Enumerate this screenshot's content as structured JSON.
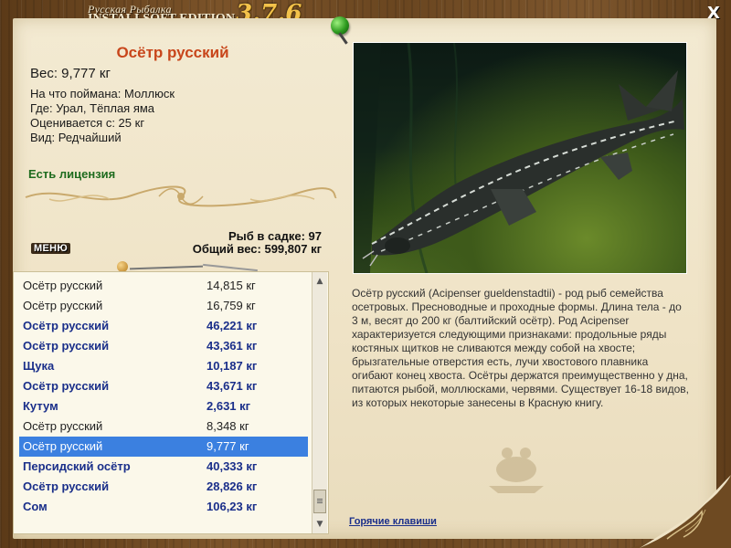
{
  "app": {
    "title_line1": "Русская Рыбалка",
    "title_line2": "INSTALLSOFT EDITION",
    "version": "3.7.6",
    "close_label": "X"
  },
  "fish": {
    "name": "Осётр русский",
    "weight_label": "Вес: 9,777 кг",
    "caught_on": "На что поймана: Моллюск",
    "location": "Где: Урал, Тёплая яма",
    "valued_from": "Оценивается с: 25 кг",
    "rarity": "Вид: Редчайший",
    "license": "Есть лицензия"
  },
  "stats": {
    "count": "Рыб в садке: 97",
    "total": "Общий вес: 599,807 кг"
  },
  "menu_label": "МЕНЮ",
  "catch_list": [
    {
      "name": "Осётр русский",
      "weight": "14,815 кг",
      "bold": false,
      "selected": false
    },
    {
      "name": "Осётр русский",
      "weight": "16,759 кг",
      "bold": false,
      "selected": false
    },
    {
      "name": "Осётр русский",
      "weight": "46,221 кг",
      "bold": true,
      "selected": false
    },
    {
      "name": "Осётр русский",
      "weight": "43,361 кг",
      "bold": true,
      "selected": false
    },
    {
      "name": "Щука",
      "weight": "10,187 кг",
      "bold": true,
      "selected": false
    },
    {
      "name": "Осётр русский",
      "weight": "43,671 кг",
      "bold": true,
      "selected": false
    },
    {
      "name": "Кутум",
      "weight": "2,631 кг",
      "bold": true,
      "selected": false
    },
    {
      "name": "Осётр русский",
      "weight": "8,348 кг",
      "bold": false,
      "selected": false
    },
    {
      "name": "Осётр русский",
      "weight": "9,777 кг",
      "bold": false,
      "selected": true
    },
    {
      "name": "Персидский осётр",
      "weight": "40,333 кг",
      "bold": true,
      "selected": false
    },
    {
      "name": "Осётр русский",
      "weight": "28,826 кг",
      "bold": true,
      "selected": false
    },
    {
      "name": "Сом",
      "weight": "106,23 кг",
      "bold": true,
      "selected": false
    }
  ],
  "description": "Осётр русский (Acipenser gueldenstadtii) - род рыб семейства осетровых. Пресноводные и проходные формы. Длина тела - до 3 м, весят до 200 кг (балтийский осётр). Род Acipenser характеризуется следующими признаками: продольные ряды костяных щитков не сливаются между собой на хвосте; брызгательные отверстия есть, лучи хвостового плавника огибают конец хвоста. Осётры держатся преимущественно у дна, питаются рыбой, моллюсками, червями. Существует 16-18 видов, из которых некоторые занесены в Красную книгу.",
  "hotkeys_label": "Горячие клавиши",
  "icons": {
    "close": "close-icon",
    "pin": "pin-icon",
    "scroll_up": "arrow-up-icon",
    "scroll_down": "arrow-down-icon"
  },
  "colors": {
    "title_red": "#c8461b",
    "license_green": "#1e6b1e",
    "bold_row_blue": "#1a2f8a",
    "selection_blue": "#3b80e0"
  }
}
